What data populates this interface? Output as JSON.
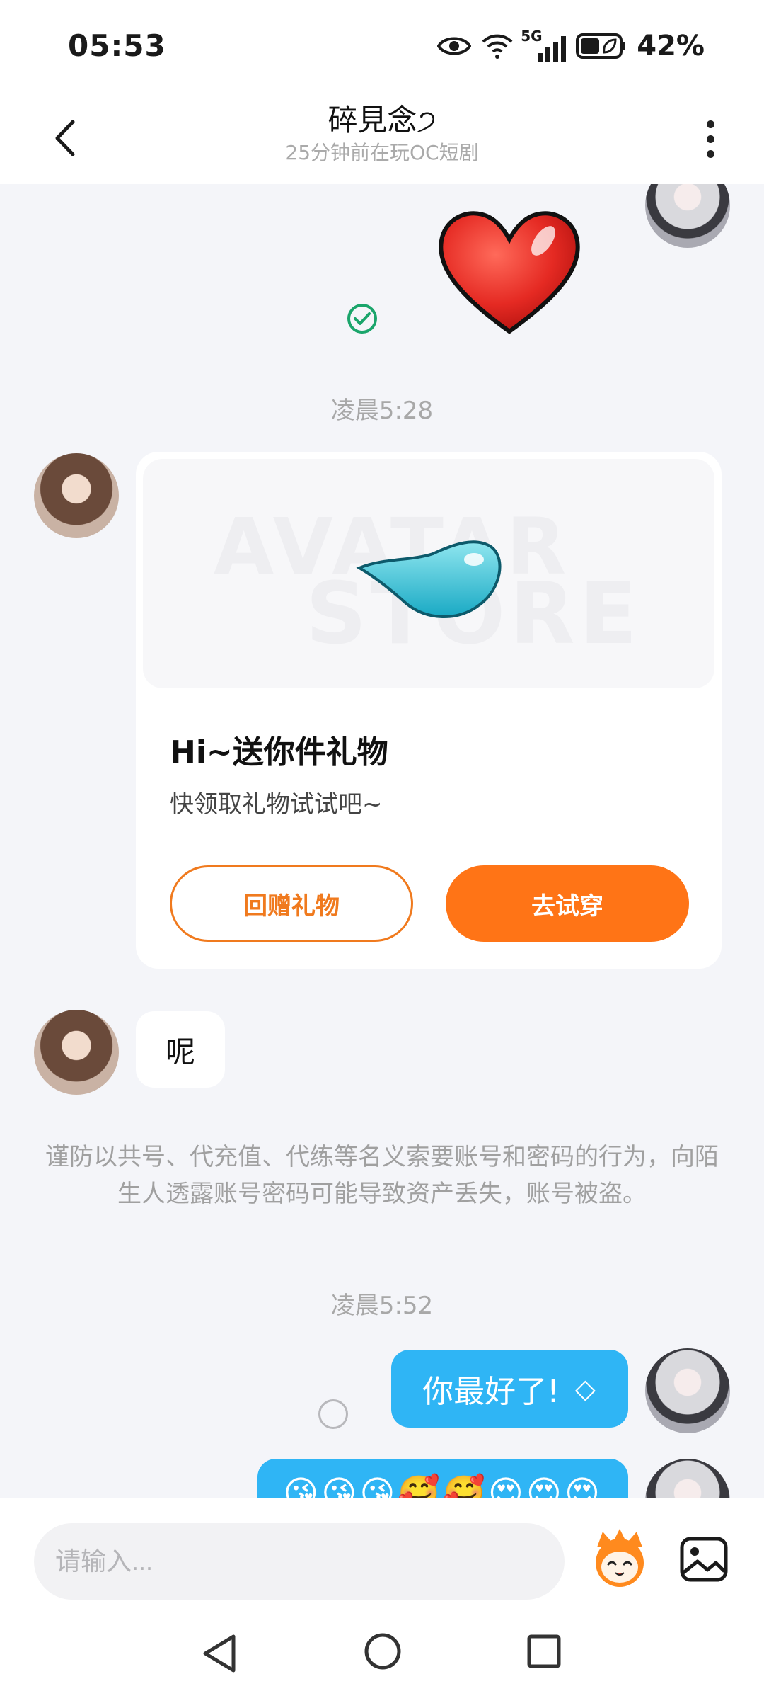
{
  "status_bar": {
    "time": "05:53",
    "network": "5G",
    "battery": "42%",
    "icons": [
      "eye-icon",
      "wifi-icon",
      "signal-icon",
      "battery-icon"
    ]
  },
  "header": {
    "title": "碎見念੭",
    "subtitle": "25分钟前在玩OC短剧",
    "back_icon": "chevron-left-icon",
    "more_icon": "more-vertical-icon"
  },
  "chat": {
    "timestamp_1": "凌晨5:28",
    "gift_card": {
      "watermark_1": "AVATAR",
      "watermark_2": "STORE",
      "title": "Hi~送你件礼物",
      "subtitle": "快领取礼物试试吧~",
      "return_gift_label": "回赠礼物",
      "try_on_label": "去试穿"
    },
    "left_message": "呢",
    "notice": "谨防以共号、代充值、代练等名义索要账号和密码的行为，向陌生人透露账号密码可能导致资产丢失，账号被盗。",
    "timestamp_2": "凌晨5:52",
    "right_message": "你最好了!",
    "right_message_icon": "◇",
    "right_message_2": "😘😘😘🥰🥰😍😍😍"
  },
  "input": {
    "placeholder": "请输入..."
  },
  "colors": {
    "accent_orange": "#ff7416",
    "bubble_blue": "#2fb5f5",
    "check_green": "#1aa56b"
  }
}
